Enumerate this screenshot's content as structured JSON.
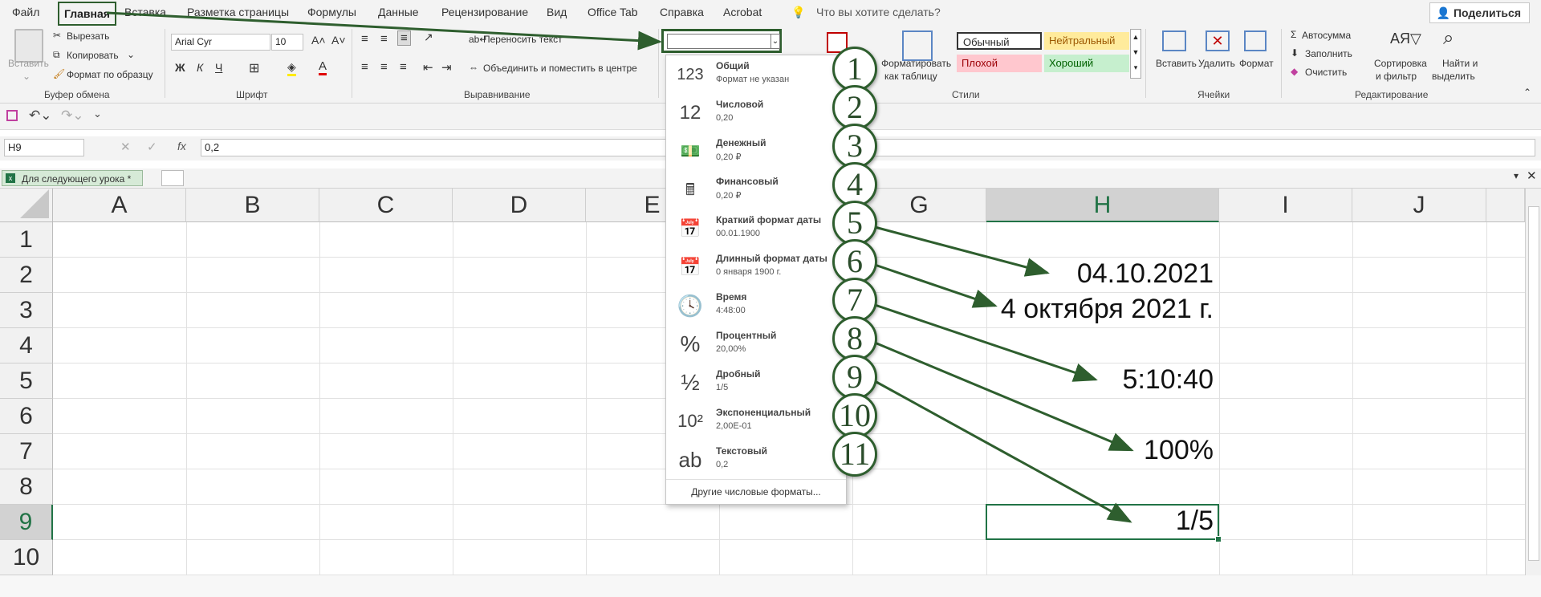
{
  "ribbon_tabs": [
    "Файл",
    "Главная",
    "Вставка",
    "Разметка страницы",
    "Формулы",
    "Данные",
    "Рецензирование",
    "Вид",
    "Office Tab",
    "Справка",
    "Acrobat"
  ],
  "tell_me": "Что вы хотите сделать?",
  "share": "Поделиться",
  "clipboard": {
    "paste": "Вставить",
    "cut": "Вырезать",
    "copy": "Копировать",
    "format_painter": "Формат по образцу",
    "label": "Буфер обмена"
  },
  "font": {
    "name": "Arial Cyr",
    "size": "10",
    "label": "Шрифт",
    "bold": "Ж",
    "italic": "К",
    "underline": "Ч"
  },
  "alignment": {
    "wrap": "Переносить текст",
    "merge": "Объединить и поместить в центре",
    "label": "Выравнивание"
  },
  "styles": {
    "normal": "Обычный",
    "neutral": "Нейтральный",
    "bad": "Плохой",
    "good": "Хороший",
    "format_table": "Форматировать",
    "format_table2": "как таблицу",
    "label": "Стили"
  },
  "cells": {
    "insert": "Вставить",
    "delete": "Удалить",
    "format": "Формат",
    "label": "Ячейки"
  },
  "editing": {
    "autosum": "Автосумма",
    "fill": "Заполнить",
    "clear": "Очистить",
    "sort": "Сортировка",
    "sort2": "и фильтр",
    "find": "Найти и",
    "find2": "выделить",
    "label": "Редактирование"
  },
  "formula_bar": {
    "name_box": "H9",
    "fx": "fx",
    "value": "0,2"
  },
  "sheet_tab": "Для следующего урока *",
  "columns": [
    "A",
    "B",
    "C",
    "D",
    "E",
    "F",
    "G",
    "H",
    "I",
    "J"
  ],
  "rows": [
    "1",
    "2",
    "3",
    "4",
    "5",
    "6",
    "7",
    "8",
    "9",
    "10"
  ],
  "cell_values": {
    "h2": "04.10.2021",
    "h3": "4 октября 2021 г.",
    "h5": "5:10:40",
    "h7": "100%",
    "h9": "1/5"
  },
  "number_formats": [
    {
      "icon": "123",
      "name": "Общий",
      "example": "Формат не указан",
      "num": "1"
    },
    {
      "icon": "12",
      "name": "Числовой",
      "example": "0,20",
      "num": "2"
    },
    {
      "icon": "money",
      "name": "Денежный",
      "example": "0,20 ₽",
      "num": "3"
    },
    {
      "icon": "calc",
      "name": "Финансовый",
      "example": "0,20 ₽",
      "num": "4"
    },
    {
      "icon": "calendar",
      "name": "Краткий формат даты",
      "example": "00.01.1900",
      "num": "5"
    },
    {
      "icon": "calendar",
      "name": "Длинный формат даты",
      "example": "0 января 1900 г.",
      "num": "6"
    },
    {
      "icon": "clock",
      "name": "Время",
      "example": "4:48:00",
      "num": "7"
    },
    {
      "icon": "%",
      "name": "Процентный",
      "example": "20,00%",
      "num": "8"
    },
    {
      "icon": "½",
      "name": "Дробный",
      "example": "1/5",
      "num": "9"
    },
    {
      "icon": "10²",
      "name": "Экспоненциальный",
      "example": "2,00E-01",
      "num": "10"
    },
    {
      "icon": "ab",
      "name": "Текстовый",
      "example": "0,2",
      "num": "11"
    }
  ],
  "more_formats": "Другие числовые форматы...",
  "accent_color": "#2e5e2e",
  "excel_green": "#217346"
}
